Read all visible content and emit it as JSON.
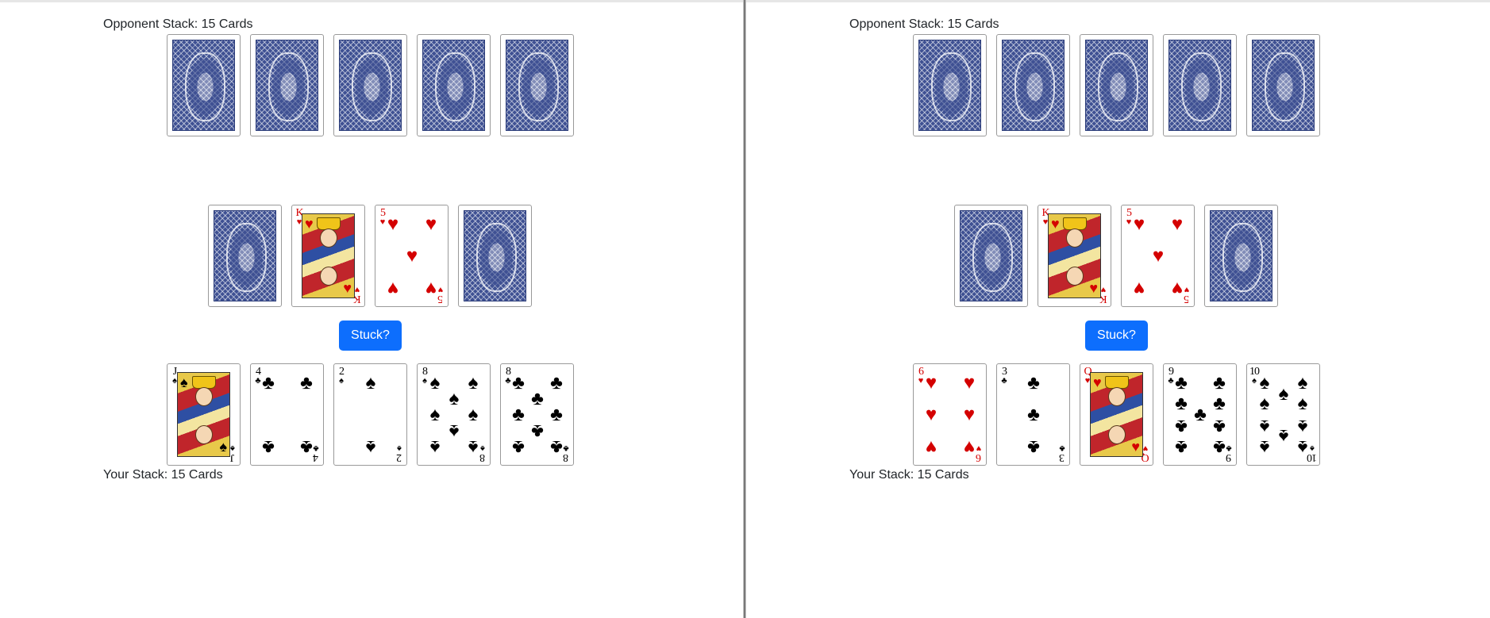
{
  "panels": [
    {
      "opponent_stack_label": "Opponent Stack: 15 Cards",
      "opponent_cards": [
        "back",
        "back",
        "back",
        "back",
        "back"
      ],
      "middle_cards": [
        {
          "kind": "back"
        },
        {
          "kind": "face",
          "rank": "K",
          "suit": "♥",
          "color": "red"
        },
        {
          "kind": "pip",
          "rank": "5",
          "suit": "♥",
          "color": "red"
        },
        {
          "kind": "back"
        }
      ],
      "stuck_button": "Stuck?",
      "your_cards": [
        {
          "kind": "face",
          "rank": "J",
          "suit": "♠",
          "color": "blk"
        },
        {
          "kind": "pip",
          "rank": "4",
          "suit": "♣",
          "color": "blk"
        },
        {
          "kind": "pip",
          "rank": "2",
          "suit": "♠",
          "color": "blk"
        },
        {
          "kind": "pip",
          "rank": "8",
          "suit": "♠",
          "color": "blk"
        },
        {
          "kind": "pip",
          "rank": "8",
          "suit": "♣",
          "color": "blk"
        }
      ],
      "your_stack_label": "Your Stack: 15 Cards"
    },
    {
      "opponent_stack_label": "Opponent Stack: 15 Cards",
      "opponent_cards": [
        "back",
        "back",
        "back",
        "back",
        "back"
      ],
      "middle_cards": [
        {
          "kind": "back"
        },
        {
          "kind": "face",
          "rank": "K",
          "suit": "♥",
          "color": "red"
        },
        {
          "kind": "pip",
          "rank": "5",
          "suit": "♥",
          "color": "red"
        },
        {
          "kind": "back"
        }
      ],
      "stuck_button": "Stuck?",
      "your_cards": [
        {
          "kind": "pip",
          "rank": "6",
          "suit": "♥",
          "color": "red"
        },
        {
          "kind": "pip",
          "rank": "3",
          "suit": "♣",
          "color": "blk"
        },
        {
          "kind": "face",
          "rank": "Q",
          "suit": "♥",
          "color": "red"
        },
        {
          "kind": "pip",
          "rank": "9",
          "suit": "♣",
          "color": "blk"
        },
        {
          "kind": "pip",
          "rank": "10",
          "suit": "♠",
          "color": "blk"
        }
      ],
      "your_stack_label": "Your Stack: 15 Cards"
    }
  ],
  "colors": {
    "accent": "#0d6efd",
    "red_suit": "#d40000",
    "card_back": "#3f5193"
  }
}
